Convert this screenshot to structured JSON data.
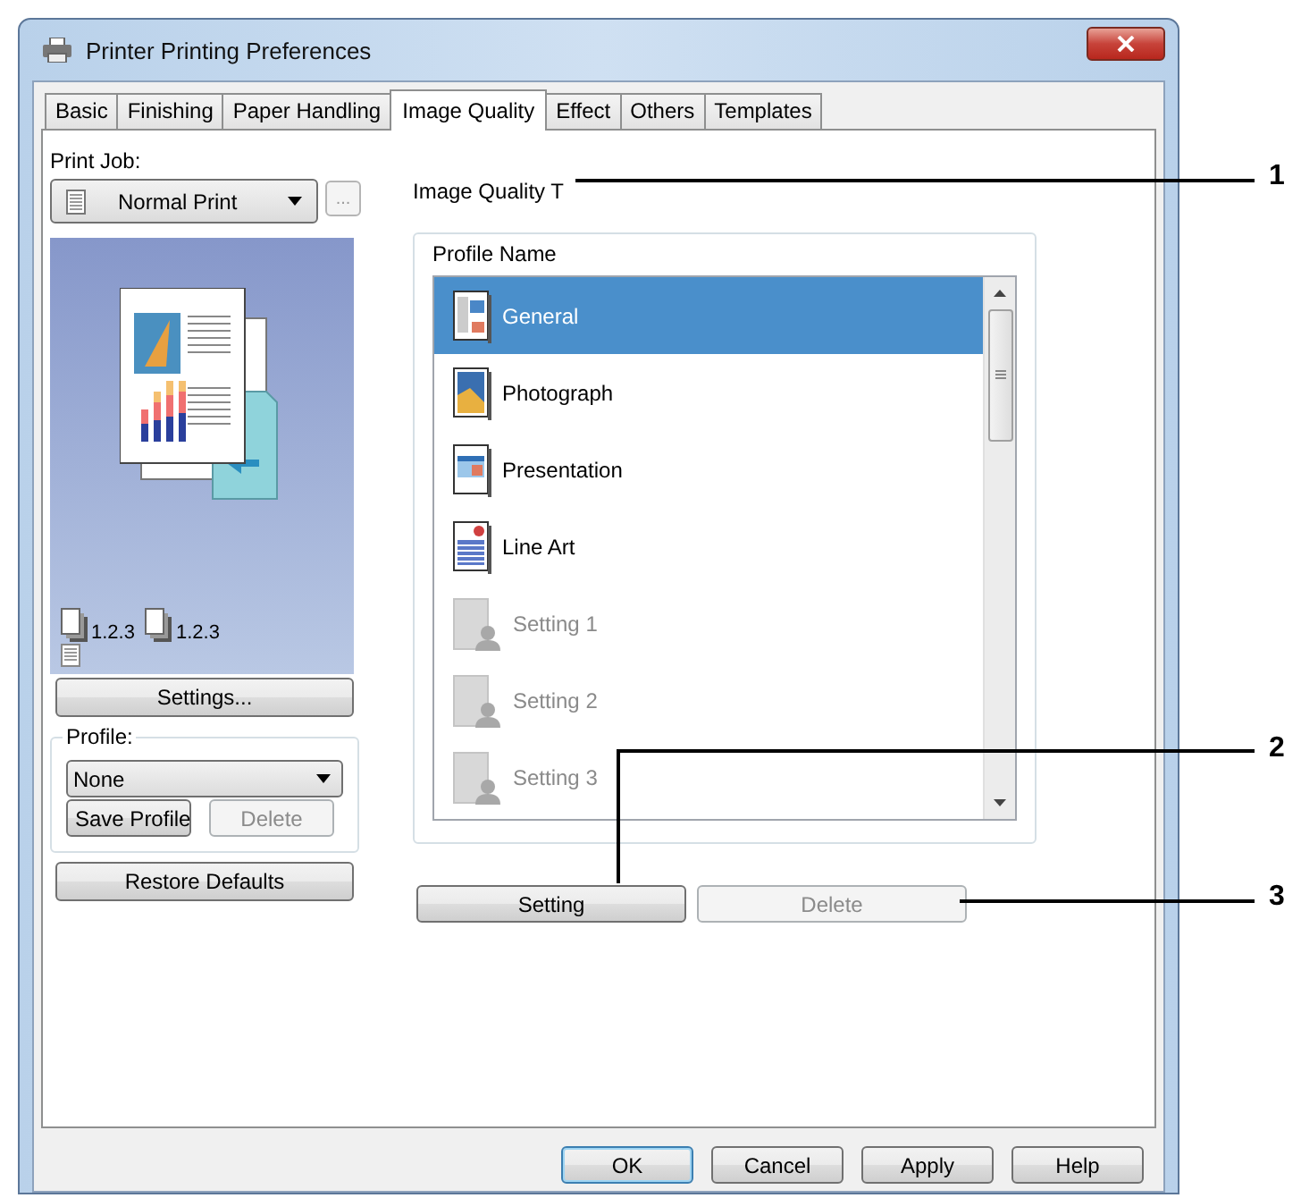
{
  "window": {
    "title": "Printer Printing Preferences"
  },
  "tabs": [
    {
      "label": "Basic",
      "selected": false
    },
    {
      "label": "Finishing",
      "selected": false
    },
    {
      "label": "Paper Handling",
      "selected": false
    },
    {
      "label": "Image Quality",
      "selected": true
    },
    {
      "label": "Effect",
      "selected": false
    },
    {
      "label": "Others",
      "selected": false
    },
    {
      "label": "Templates",
      "selected": false
    }
  ],
  "print_job": {
    "label": "Print Job:",
    "value": "Normal Print",
    "more_button": {
      "label": "...",
      "disabled": true
    }
  },
  "preview": {
    "labels": [
      "1.2.3",
      "1.2.3"
    ]
  },
  "settings_button": "Settings...",
  "profile": {
    "label": "Profile:",
    "value": "None",
    "buttons": [
      {
        "label": "Save Profile",
        "disabled": false
      },
      {
        "label": "Delete",
        "disabled": true
      }
    ]
  },
  "restore_button": "Restore Defaults",
  "image_quality_label": "Image Quality T",
  "profile_list": {
    "title": "Profile Name",
    "items": [
      {
        "label": "General",
        "kind": "general",
        "selected": true,
        "disabled": false
      },
      {
        "label": "Photograph",
        "kind": "photo",
        "selected": false,
        "disabled": false
      },
      {
        "label": "Presentation",
        "kind": "presentation",
        "selected": false,
        "disabled": false
      },
      {
        "label": "Line Art",
        "kind": "line_art",
        "selected": false,
        "disabled": false
      },
      {
        "label": "Setting 1",
        "kind": "custom",
        "selected": false,
        "disabled": true
      },
      {
        "label": "Setting 2",
        "kind": "custom",
        "selected": false,
        "disabled": true
      },
      {
        "label": "Setting 3",
        "kind": "custom",
        "selected": false,
        "disabled": true
      }
    ]
  },
  "list_buttons": [
    {
      "label": "Setting",
      "disabled": false
    },
    {
      "label": "Delete",
      "disabled": true
    }
  ],
  "dialog_buttons": [
    {
      "label": "OK",
      "default": true
    },
    {
      "label": "Cancel",
      "default": false
    },
    {
      "label": "Apply",
      "default": false
    },
    {
      "label": "Help",
      "default": false
    }
  ],
  "callouts": [
    "1",
    "2",
    "3"
  ]
}
